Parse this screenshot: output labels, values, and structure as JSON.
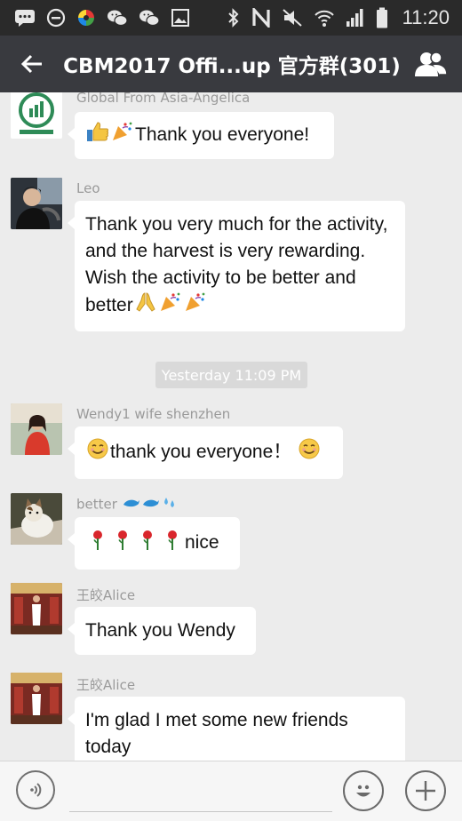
{
  "status_bar": {
    "time": "11:20",
    "left_icons": [
      "messages-icon",
      "block-icon",
      "photos-icon",
      "wechat-icon",
      "wechat-icon",
      "gallery-icon"
    ],
    "right_icons": [
      "bluetooth-icon",
      "nfc-icon",
      "mute-icon",
      "wifi-icon",
      "signal-icon",
      "battery-icon"
    ]
  },
  "header": {
    "title": "CBM2017 Offi...up 官方群(301)",
    "colors": {
      "bar": "#393a3f",
      "status": "#2a2a2a",
      "text": "#ffffff"
    }
  },
  "messages": [
    {
      "sender": "Global From Asia-Angelica",
      "avatar": "logo-avatar-icon",
      "text": "Thank you everyone!",
      "emojis_before": [
        "thumbs-up-icon",
        "party-popper-icon"
      ],
      "emojis_after": []
    },
    {
      "sender": "Leo",
      "avatar": "driver-avatar-icon",
      "text": "Thank you very much for the activity, and the harvest is very rewarding. Wish the activity to be better and better",
      "emojis_before": [],
      "emojis_after": [
        "folded-hands-icon",
        "party-popper-icon",
        "party-popper-icon"
      ]
    },
    {
      "sender": "Wendy1 wife shenzhen",
      "avatar": "woman-avatar-icon",
      "text": "thank you everyone！",
      "emojis_before": [
        "smiling-face-icon"
      ],
      "emojis_after": [
        "smiling-face-icon"
      ]
    },
    {
      "sender": "better",
      "sender_emojis": [
        "dolphin-icon",
        "dolphin-icon",
        "droplets-icon"
      ],
      "avatar": "cat-avatar-icon",
      "text": "nice",
      "emojis_before": [
        "rose-icon",
        "rose-icon",
        "rose-icon",
        "rose-icon"
      ],
      "emojis_after": []
    },
    {
      "sender": "王皎Alice",
      "avatar": "alice-avatar-icon",
      "text": "Thank you Wendy",
      "emojis_before": [],
      "emojis_after": []
    },
    {
      "sender": "王皎Alice",
      "avatar": "alice-avatar-icon",
      "text": "I'm glad I met some new friends today",
      "emojis_before": [],
      "emojis_after": []
    }
  ],
  "timestamp": "Yesterday 11:09 PM",
  "input_bar": {
    "voice_icon": "voice-icon",
    "emoji_icon": "emoji-icon",
    "plus_icon": "plus-icon",
    "value": ""
  }
}
